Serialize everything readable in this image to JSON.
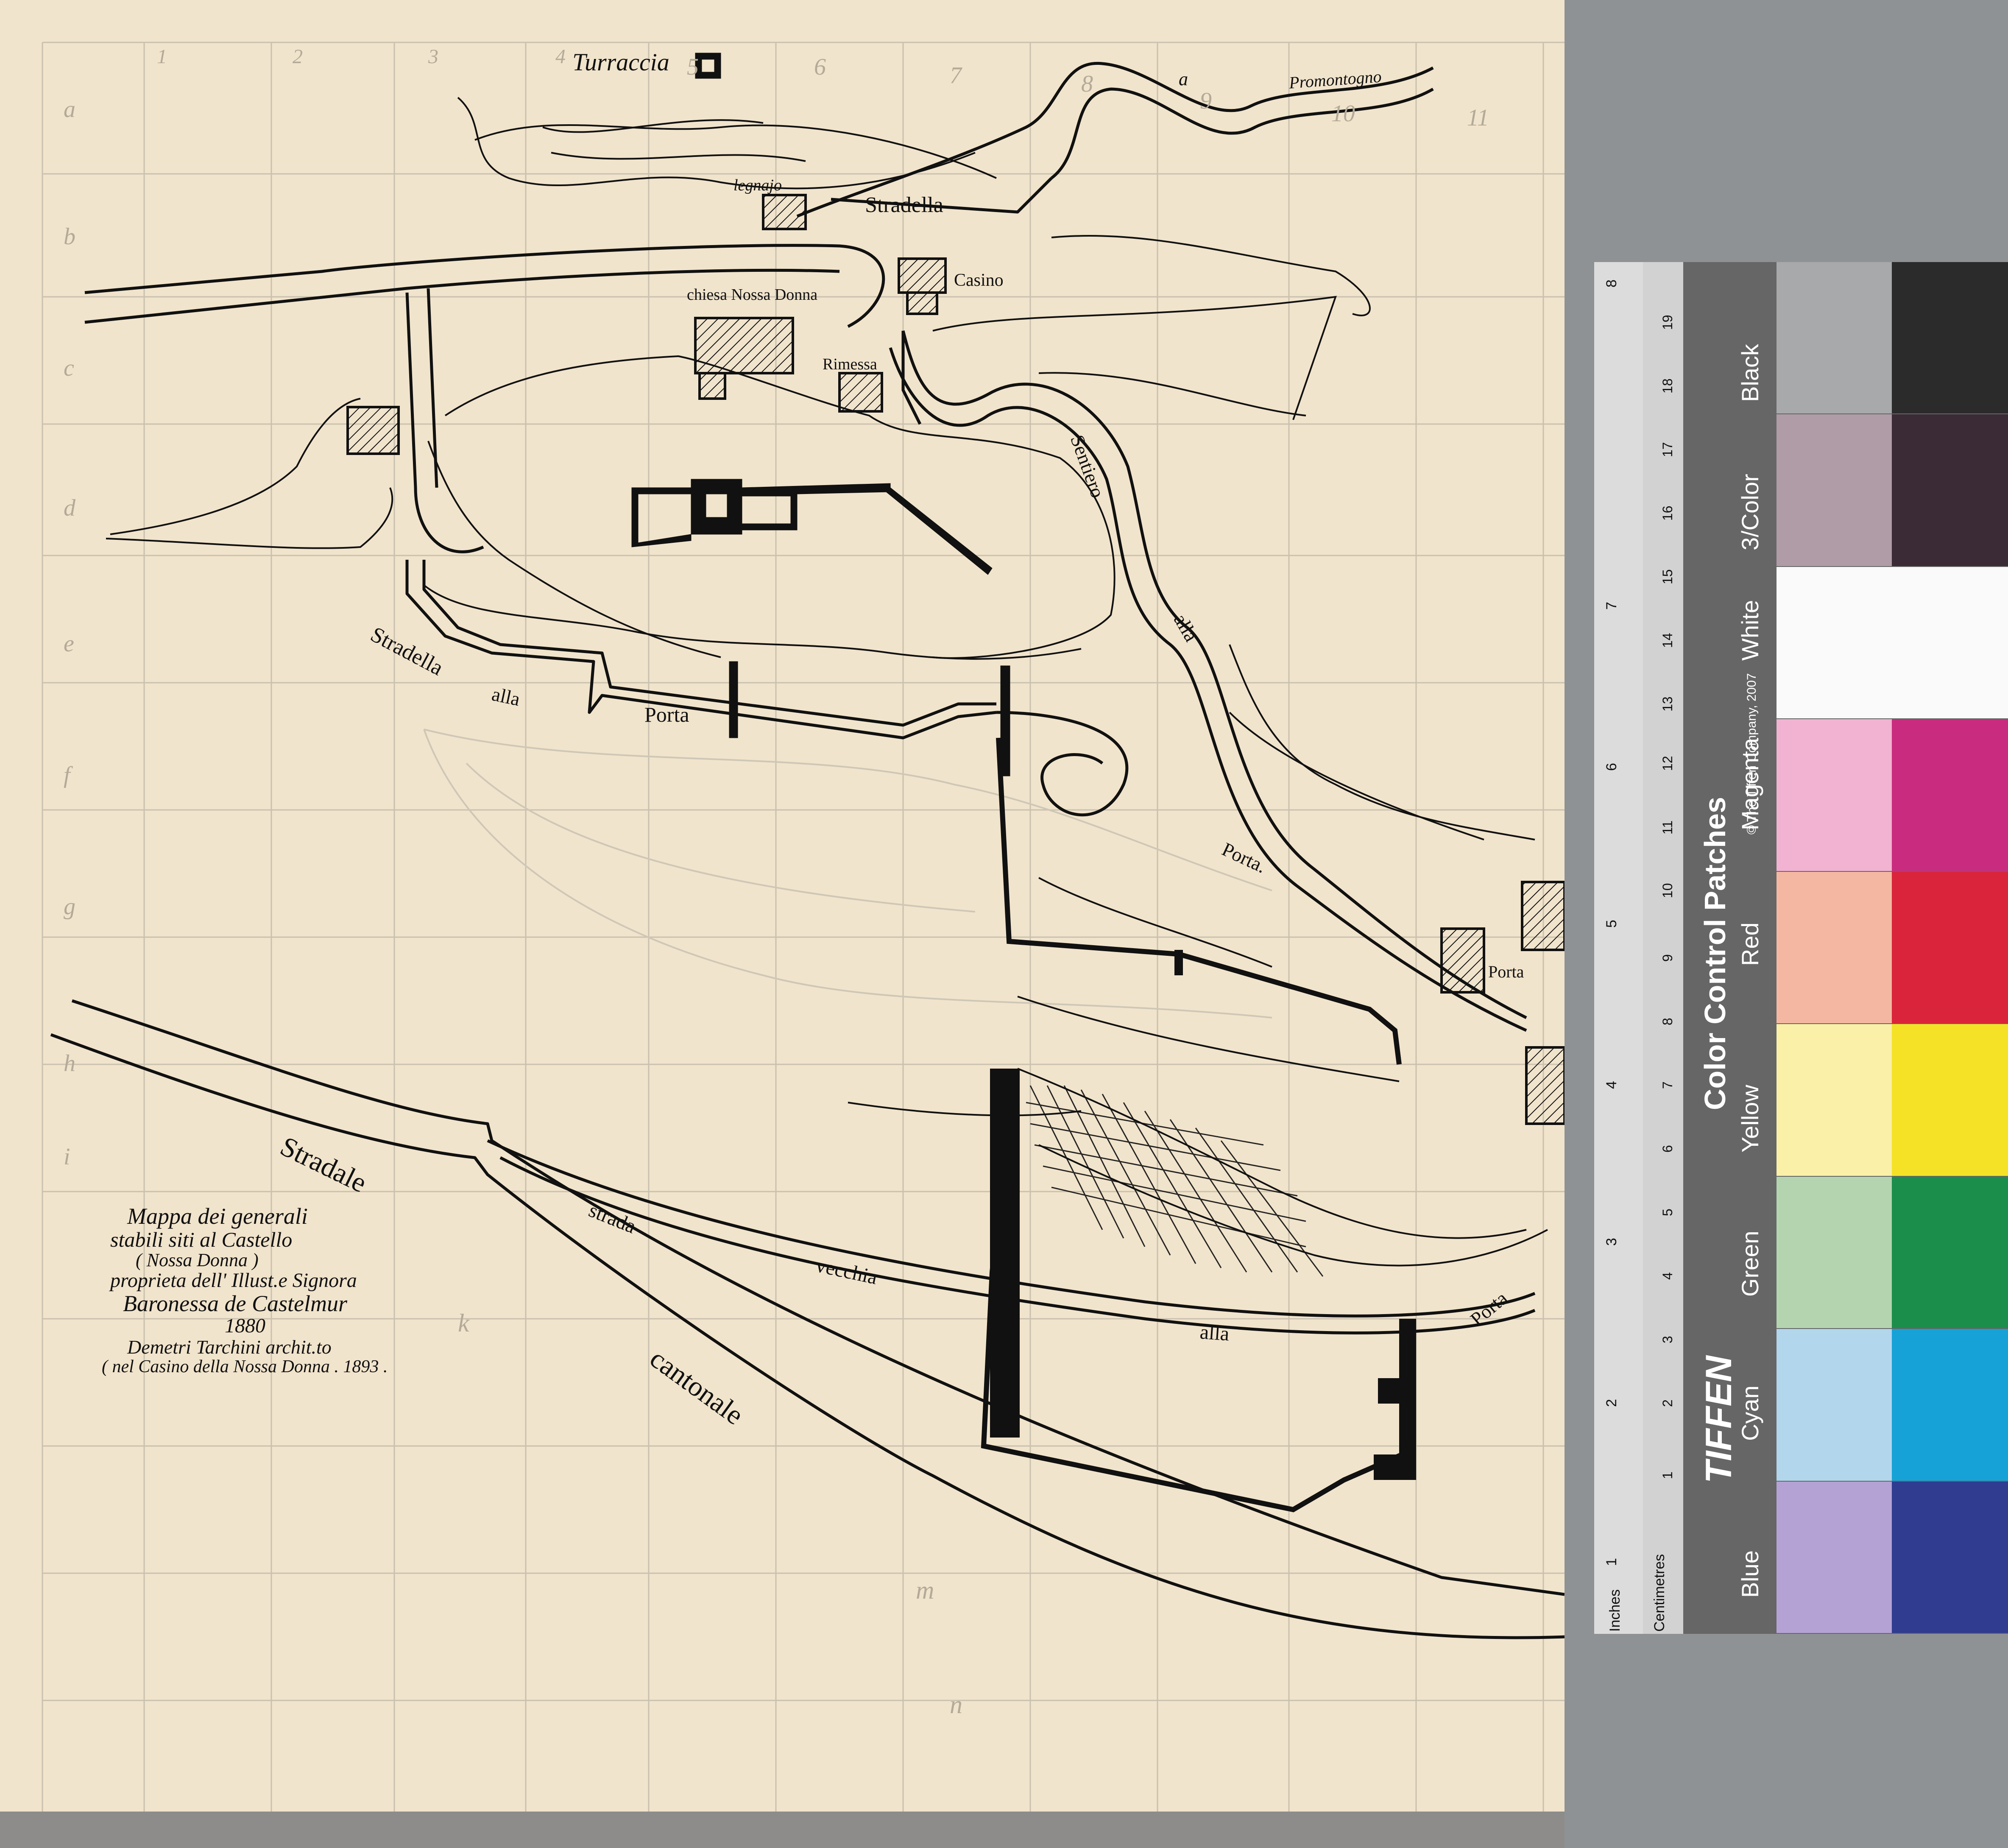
{
  "map": {
    "labels": {
      "turraccia": "Turraccia",
      "promontogno": "Promontogno",
      "a_promontogno": "a",
      "legnajo": "legnajo",
      "stradella_top": "Stradella",
      "casino": "Casino",
      "chiesa": "chiesa Nossa Donna",
      "rimessa": "Rimessa",
      "sentiero": "Sentiero",
      "alla_sentiero": "alla",
      "porta_sentiero": "Porta.",
      "porta_east": "Porta",
      "stradella_porta_1": "Stradella",
      "stradella_porta_2": "alla",
      "stradella_porta_3": "Porta",
      "stradale": "Stradale",
      "cantonale": "cantonale",
      "strada": "strada",
      "vecchia": "vecchia",
      "alla_vecchia": "alla",
      "porta_vecchia": "Porta"
    },
    "title_block": [
      "Mappa dei generali",
      "stabili siti al Castello",
      "( Nossa Donna )",
      "proprieta dell' Illust.e Signora",
      "Baronessa de Castelmur",
      "1880",
      "Demetri Tarchini archit.to",
      "( nel Casino della Nossa Donna . 1893 ."
    ],
    "grid_columns": [
      "1",
      "2",
      "3",
      "4",
      "5",
      "6",
      "7",
      "8",
      "9",
      "10",
      "11"
    ],
    "grid_rows": [
      "a",
      "b",
      "c",
      "d",
      "e",
      "f",
      "g",
      "h",
      "i",
      "k",
      "m",
      "n"
    ]
  },
  "color_card": {
    "brand": "TIFFEN",
    "title": "Color Control Patches",
    "copyright": "© The Tiffen Company, 2007",
    "ruler_inches": "Inches",
    "ruler_cm": "Centimetres",
    "inch_ticks": [
      "1",
      "2",
      "3",
      "4",
      "5",
      "6",
      "7",
      "8"
    ],
    "cm_ticks": [
      "1",
      "2",
      "3",
      "4",
      "5",
      "6",
      "7",
      "8",
      "9",
      "10",
      "11",
      "12",
      "13",
      "14",
      "15",
      "16",
      "17",
      "18",
      "19"
    ],
    "patches": [
      {
        "name": "Blue",
        "light": "#b5a2d4",
        "dark": "#2f3c8f"
      },
      {
        "name": "Cyan",
        "light": "#b2d6ec",
        "dark": "#16a2d7"
      },
      {
        "name": "Green",
        "light": "#b4d4b0",
        "dark": "#1b8e4c"
      },
      {
        "name": "Yellow",
        "light": "#fbf0a8",
        "dark": "#f5e227"
      },
      {
        "name": "Red",
        "light": "#f4b8a2",
        "dark": "#d9243b"
      },
      {
        "name": "Magenta",
        "light": "#f1b3d1",
        "dark": "#c92c7e"
      },
      {
        "name": "White",
        "light": "#fafafa",
        "dark": "#fafafa"
      },
      {
        "name": "3/Color",
        "light": "#b09ca6",
        "dark": "#3b2b37"
      },
      {
        "name": "Black",
        "light": "#a8a9ab",
        "dark": "#2b2b2b"
      }
    ]
  },
  "colors": {
    "paper": "#f1e4cc",
    "ink": "#111111",
    "pencil": "#b3aa98"
  }
}
